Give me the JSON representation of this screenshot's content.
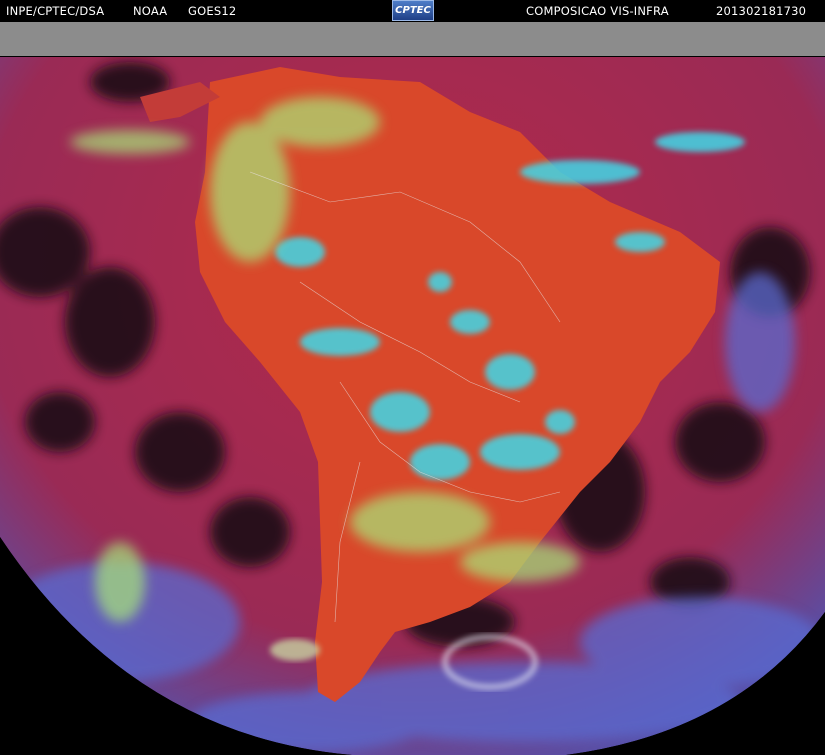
{
  "header": {
    "agency": "INPE/CPTEC/DSA",
    "source": "NOAA",
    "satellite": "GOES12",
    "logo_text": "CPTEC",
    "product": "COMPOSICAO VIS-INFRA",
    "timestamp": "201302181730"
  },
  "colors": {
    "background": "#000000",
    "no_data_gray": "#8c8c8c",
    "ocean_red": "#a3243f",
    "land_orange": "#d9482a",
    "cloud_cyan": "#3fd8e8",
    "cloud_green": "#a8e67a",
    "border_lines": "#e8e0e0"
  },
  "image": {
    "description_icons": [
      "satellite-earth-disk",
      "south-america-continent"
    ]
  }
}
